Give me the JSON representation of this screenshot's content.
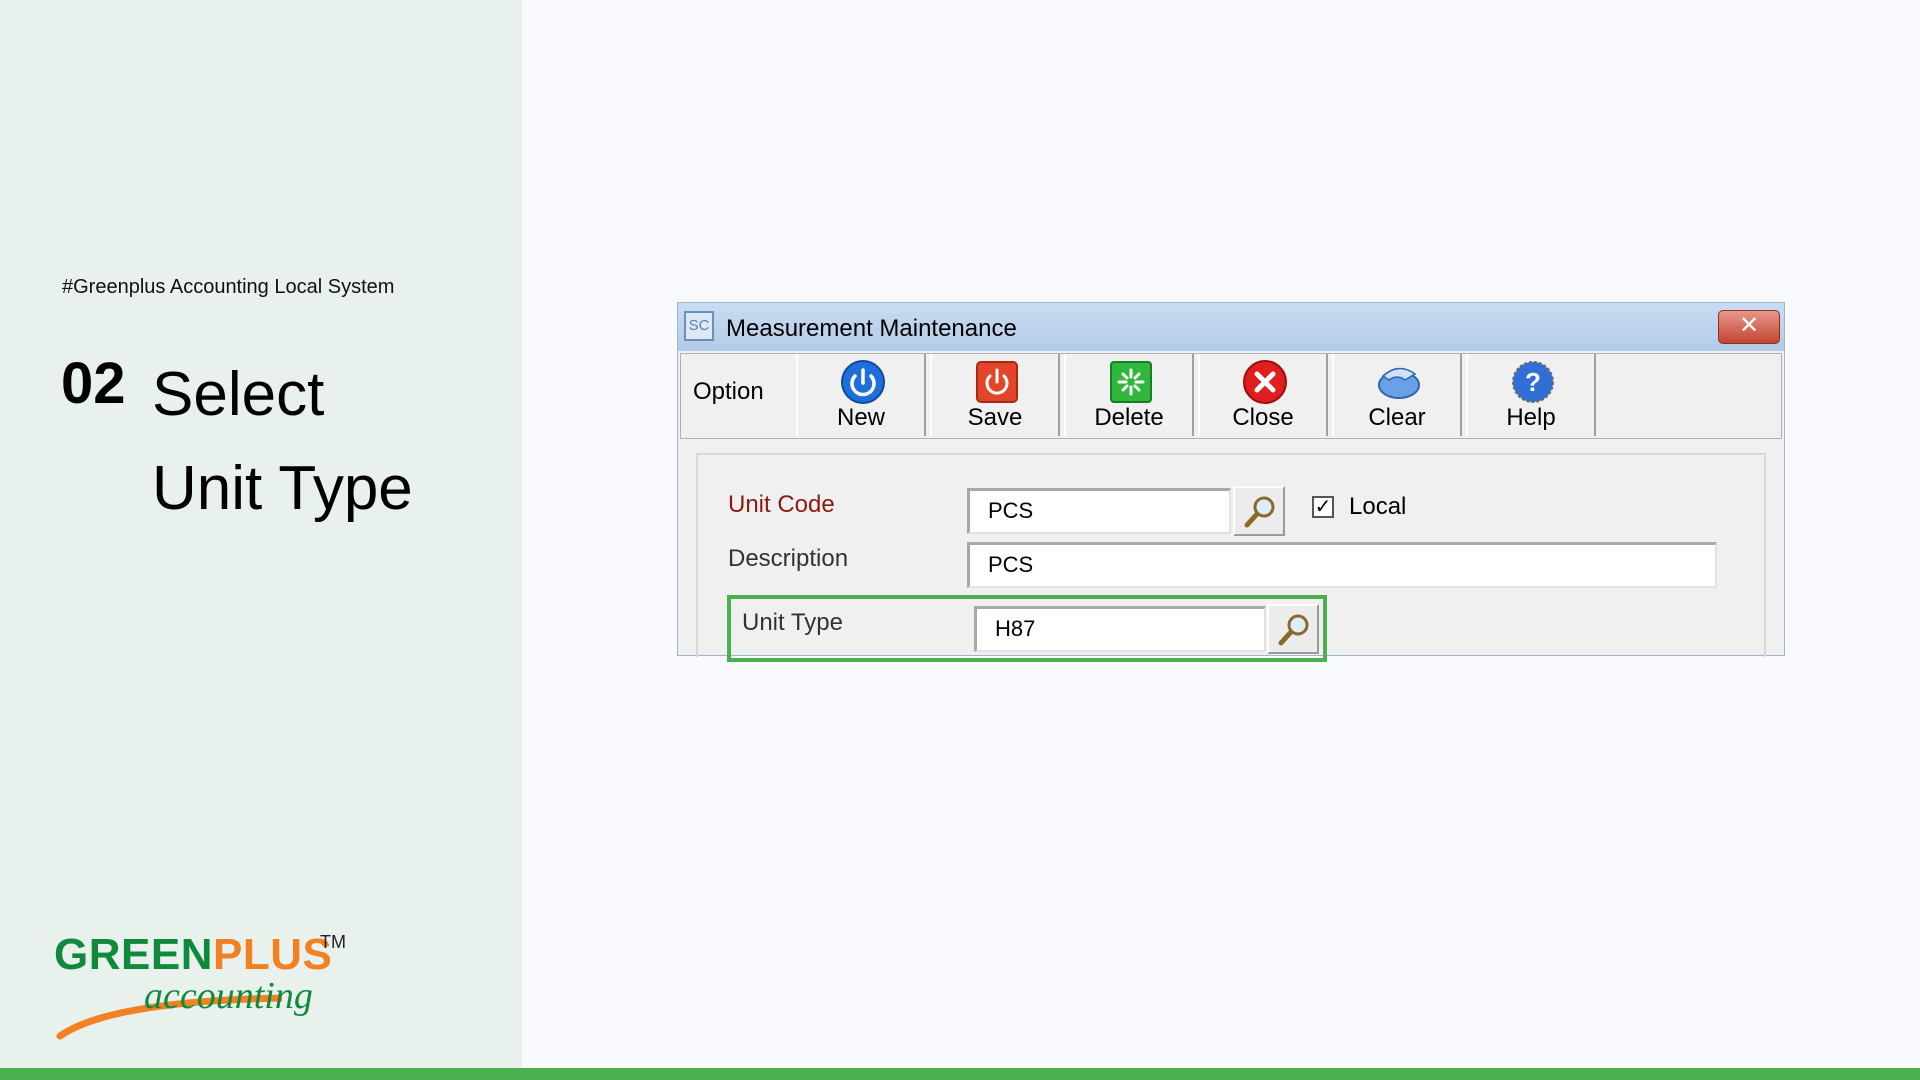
{
  "slide": {
    "tagline": "#Greenplus Accounting Local System",
    "step_number": "02",
    "step_title_line1": "Select",
    "step_title_line2": "Unit Type"
  },
  "logo": {
    "brand_green": "GREEN",
    "brand_orange": "PLUS",
    "trademark": "TM",
    "script": "accounting",
    "colors": {
      "green": "#0f8a3c",
      "orange": "#f28123"
    }
  },
  "window": {
    "title": "Measurement Maintenance",
    "app_icon_text": "SC",
    "close_glyph": "✕"
  },
  "toolbar": {
    "option_label": "Option",
    "buttons": [
      {
        "label": "New",
        "icon": "power-icon"
      },
      {
        "label": "Save",
        "icon": "save-icon"
      },
      {
        "label": "Delete",
        "icon": "delete-icon"
      },
      {
        "label": "Close",
        "icon": "close-circle-icon"
      },
      {
        "label": "Clear",
        "icon": "clear-icon"
      },
      {
        "label": "Help",
        "icon": "help-icon"
      }
    ]
  },
  "form": {
    "unit_code_label": "Unit Code",
    "unit_code_value": "PCS",
    "local_label": "Local",
    "local_checked": true,
    "check_glyph": "✓",
    "description_label": "Description",
    "description_value": "PCS",
    "unit_type_label": "Unit Type",
    "unit_type_value": "H87"
  },
  "colors": {
    "highlight": "#4caf50",
    "bottom_bar": "#4caf50",
    "required_label": "#8c1a10"
  }
}
